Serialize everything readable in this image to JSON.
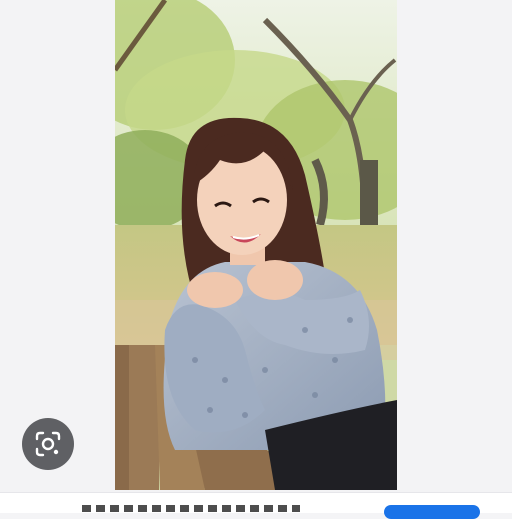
{
  "viewer": {
    "image": {
      "alt": ""
    },
    "lens_button": {
      "icon": "lens-search-icon",
      "label": ""
    }
  },
  "bottom_bar": {
    "caption": "",
    "action_button": {
      "label": "",
      "color": "#1a73e8"
    }
  },
  "colors": {
    "background": "#f3f3f5",
    "lens_button_bg": "#5f6064"
  }
}
